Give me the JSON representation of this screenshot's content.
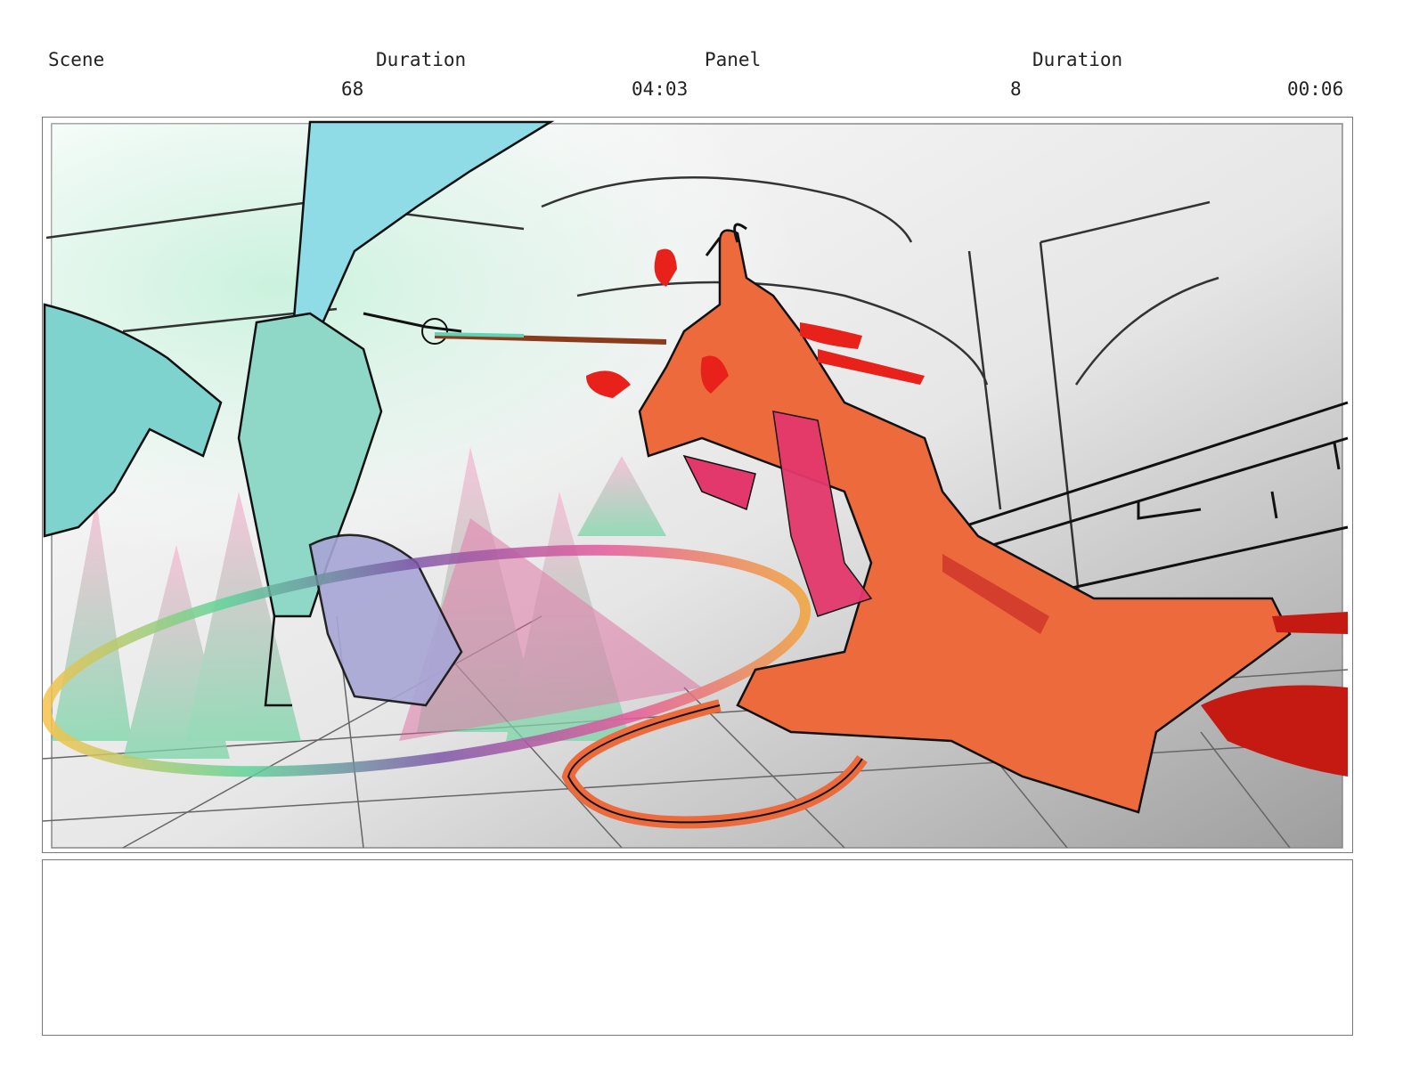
{
  "header": {
    "scene_label": "Scene",
    "scene_duration_label": "Duration",
    "panel_label": "Panel",
    "panel_duration_label": "Duration",
    "scene_number": "68",
    "scene_duration": "04:03",
    "panel_number": "8",
    "panel_duration": "00:06"
  },
  "notes": {
    "text": ""
  },
  "colors": {
    "left_figure": "#8fdbe6",
    "right_figure": "#ec6a3c",
    "blood": "#e8211a",
    "ink": "#111111"
  }
}
